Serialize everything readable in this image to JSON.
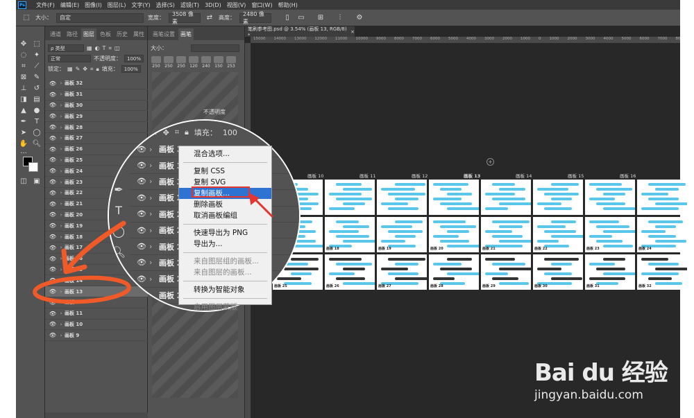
{
  "menubar": {
    "logo": "Ps",
    "items": [
      "文件(F)",
      "编辑(E)",
      "图像(I)",
      "图层(L)",
      "文字(Y)",
      "选择(S)",
      "滤镜(T)",
      "3D(D)",
      "视图(V)",
      "窗口(W)",
      "帮助(H)"
    ]
  },
  "options": {
    "size_label": "大小：",
    "size_value": "自定",
    "width_label": "宽度：",
    "width_value": "3508 像素",
    "height_label": "高度：",
    "height_value": "2480 像素"
  },
  "layers_panel": {
    "tabs": [
      "通道",
      "路径",
      "图层",
      "色板",
      "历史",
      "属性"
    ],
    "active_tab": "图层",
    "filter_label": "类型",
    "blend_mode": "正常",
    "opacity_label": "不透明度：",
    "opacity_value": "100%",
    "lock_label": "锁定：",
    "fill_label": "填充：",
    "fill_value": "100%",
    "layers": [
      "画板 32",
      "画板 31",
      "画板 30",
      "画板 29",
      "画板 28",
      "画板 27",
      "画板 26",
      "画板 25",
      "画板 24",
      "画板 23",
      "画板 22",
      "画板 21",
      "画板 20",
      "画板 19",
      "画板 18",
      "画板 17",
      "画板 16",
      "画板 15",
      "画板 14",
      "画板 13",
      "画板 12",
      "画板 11",
      "画板 10",
      "画板 9"
    ],
    "selected_layer": "画板 13"
  },
  "brush_panel": {
    "tabs": [
      "画笔设置",
      "画笔"
    ],
    "size_label": "大小：",
    "sizes": [
      "250",
      "250",
      "250",
      "120",
      "240",
      "150",
      "253"
    ],
    "opacity_label": "不透明度"
  },
  "document": {
    "tab_title": "笔刷参考图.psd @ 3.54% (画板 13, RGB/8) *",
    "ruler_ticks": [
      "15000",
      "14000",
      "13000",
      "12000",
      "11000",
      "10000",
      "9000",
      "8000",
      "7000",
      "6000",
      "5000",
      "4000",
      "3000",
      "2000",
      "1000",
      "0",
      "1000",
      "2000",
      "3000",
      "4000",
      "5000",
      "6000",
      "7000",
      "8000",
      "9000",
      "10000",
      "11000",
      "12000",
      "13000",
      "14000",
      "15000",
      "16000"
    ],
    "artboard_headers": [
      "画板 10",
      "画板 11",
      "画板 12",
      "画板 13",
      "画板 14",
      "画板 15",
      "画板 16"
    ],
    "row1_labels": [
      "画板 17",
      "画板 18",
      "画板 19",
      "画板 20",
      "画板 21",
      "画板 22",
      "画板 23",
      "画板 24"
    ],
    "row2_labels": [
      "画板 25",
      "画板 26",
      "画板 27",
      "画板 28",
      "画板 29",
      "画板 30",
      "画板 31",
      "画板 32"
    ]
  },
  "magnifier": {
    "fill_label": "填充：",
    "fill_value": "100",
    "layers": [
      "画板 32",
      "画板 31",
      "画板 30",
      "画板 29",
      "画板 28",
      "画板 27",
      "画板 26",
      "画板 25",
      "画板 24",
      "画板 23"
    ],
    "context_menu": {
      "blend_options": "混合选项...",
      "copy_css": "复制 CSS",
      "copy_svg": "复制 SVG",
      "duplicate_artboard": "复制画板...",
      "delete_artboard": "删除画板",
      "ungroup_artboard": "取消画板编组",
      "quick_export_png": "快速导出为 PNG",
      "export_as": "导出为...",
      "artboard_from_group": "来自图层组的画板...",
      "artboard_from_layers": "来自图层的画板...",
      "convert_smart_object": "转换为智能对象",
      "enable_layer_mask": "启用图层蒙版"
    }
  },
  "watermark": {
    "main": "Bai du 经验",
    "sub": "jingyan.baidu.com"
  },
  "colors": {
    "ui_dark": "#535353",
    "canvas": "#282828",
    "accent_blue": "#2e72d2",
    "annotation_orange": "#f05a28",
    "annotation_red": "#e4362e",
    "artboard_cyan": "#5ac7ea"
  }
}
